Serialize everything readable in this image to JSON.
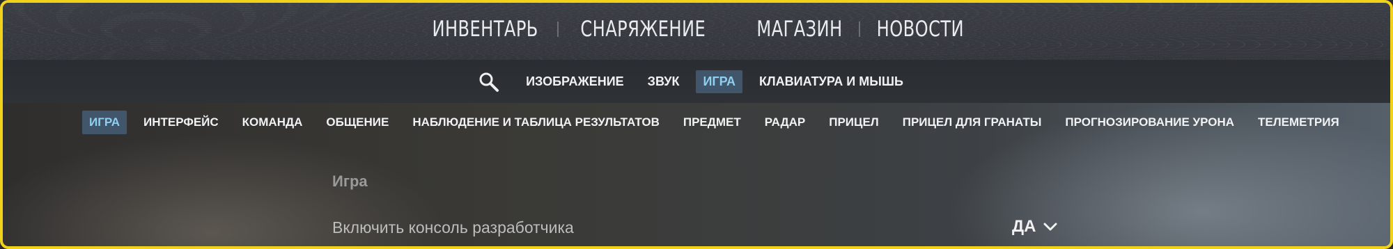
{
  "top_nav": {
    "items": [
      "ИНВЕНТАРЬ",
      "СНАРЯЖЕНИЕ",
      "МАГАЗИН",
      "НОВОСТИ"
    ]
  },
  "settings_nav": {
    "search_icon": "search-icon",
    "items": [
      {
        "label": "ИЗОБРАЖЕНИЕ",
        "active": false
      },
      {
        "label": "ЗВУК",
        "active": false
      },
      {
        "label": "ИГРА",
        "active": true
      },
      {
        "label": "КЛАВИАТУРА И МЫШЬ",
        "active": false
      }
    ]
  },
  "game_tabs": {
    "items": [
      {
        "label": "ИГРА",
        "active": true
      },
      {
        "label": "ИНТЕРФЕЙС",
        "active": false
      },
      {
        "label": "КОМАНДА",
        "active": false
      },
      {
        "label": "ОБЩЕНИЕ",
        "active": false
      },
      {
        "label": "НАБЛЮДЕНИЕ И ТАБЛИЦА РЕЗУЛЬТАТОВ",
        "active": false
      },
      {
        "label": "ПРЕДМЕТ",
        "active": false
      },
      {
        "label": "РАДАР",
        "active": false
      },
      {
        "label": "ПРИЦЕЛ",
        "active": false
      },
      {
        "label": "ПРИЦЕЛ ДЛЯ ГРАНАТЫ",
        "active": false
      },
      {
        "label": "ПРОГНОЗИРОВАНИЕ УРОНА",
        "active": false
      },
      {
        "label": "ТЕЛЕМЕТРИЯ",
        "active": false
      }
    ]
  },
  "content": {
    "section_title": "Игра",
    "settings": [
      {
        "label": "Включить консоль разработчика",
        "value": "ДА",
        "icon": "chevron-down-icon"
      }
    ]
  },
  "colors": {
    "frame_border": "#f1d21a",
    "active_tab_bg": "#41566a",
    "active_tab_text": "#8fcff0"
  }
}
